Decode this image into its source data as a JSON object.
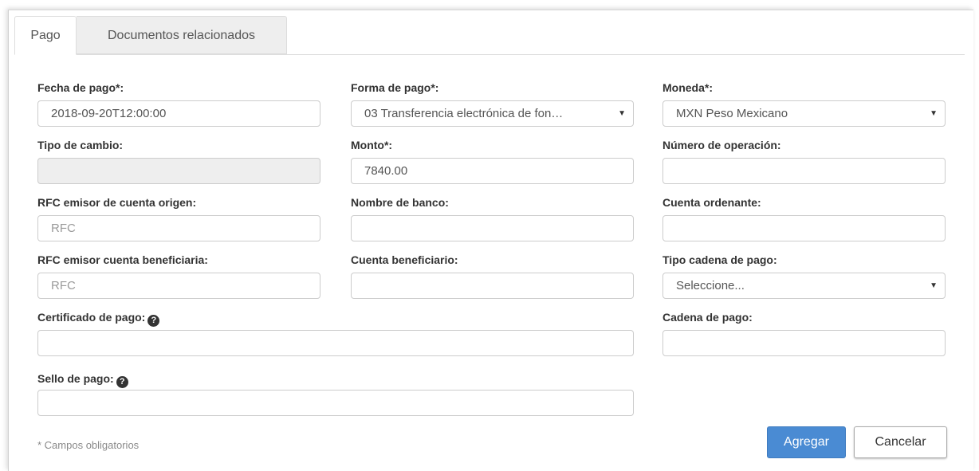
{
  "tabs": [
    {
      "label": "Pago"
    },
    {
      "label": "Documentos relacionados"
    }
  ],
  "form": {
    "fecha_pago": {
      "label": "Fecha de pago*:",
      "value": "2018-09-20T12:00:00"
    },
    "forma_pago": {
      "label": "Forma de pago*:",
      "value": "03 Transferencia electrónica de fon…"
    },
    "moneda": {
      "label": "Moneda*:",
      "value": "MXN Peso Mexicano"
    },
    "tipo_cambio": {
      "label": "Tipo de cambio:",
      "value": ""
    },
    "monto": {
      "label": "Monto*:",
      "value": "7840.00"
    },
    "numero_operacion": {
      "label": "Número de operación:",
      "value": ""
    },
    "rfc_origen": {
      "label": "RFC emisor de cuenta origen:",
      "placeholder": "RFC"
    },
    "nombre_banco": {
      "label": "Nombre de banco:",
      "value": ""
    },
    "cuenta_ordenante": {
      "label": "Cuenta ordenante:",
      "value": ""
    },
    "rfc_beneficiaria": {
      "label": "RFC emisor cuenta beneficiaria:",
      "placeholder": "RFC"
    },
    "cuenta_beneficiario": {
      "label": "Cuenta beneficiario:",
      "value": ""
    },
    "tipo_cadena": {
      "label": "Tipo cadena de pago:",
      "value": "Seleccione..."
    },
    "certificado": {
      "label": "Certificado de pago:",
      "value": ""
    },
    "cadena_pago": {
      "label": "Cadena de pago:",
      "value": ""
    },
    "sello": {
      "label": "Sello de pago:",
      "value": ""
    }
  },
  "icons": {
    "help": "question-circle-icon",
    "caret": "caret-down-icon"
  },
  "note": "* Campos obligatorios",
  "buttons": {
    "add": "Agregar",
    "cancel": "Cancelar"
  },
  "colors": {
    "primary": "#4a8bd3",
    "disabled_bg": "#eeeeee",
    "tab_inactive_bg": "#eeeeee"
  }
}
